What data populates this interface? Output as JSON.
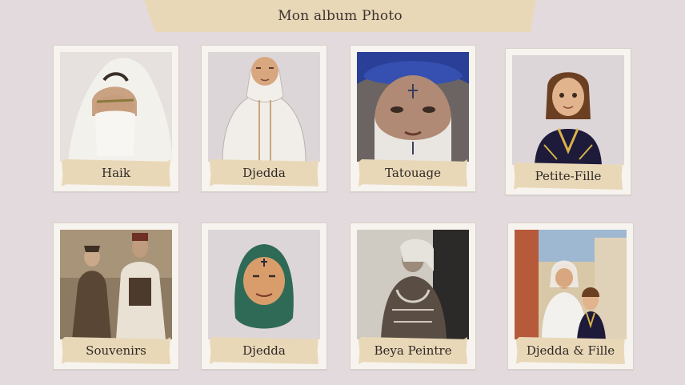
{
  "header": {
    "title": "Mon album Photo"
  },
  "cards": [
    {
      "label": "Haik",
      "icon": "haik-photo"
    },
    {
      "label": "Djedda",
      "icon": "djedda-illustration"
    },
    {
      "label": "Tatouage",
      "icon": "tatouage-photo"
    },
    {
      "label": "Petite-Fille",
      "icon": "petite-fille-illustration"
    },
    {
      "label": "Souvenirs",
      "icon": "souvenirs-photo"
    },
    {
      "label": "Djedda",
      "icon": "djedda-portrait-illustration"
    },
    {
      "label": "Beya Peintre",
      "icon": "beya-photo"
    },
    {
      "label": "Djedda & Fille",
      "icon": "djedda-fille-illustration"
    }
  ],
  "colors": {
    "background": "#e3dadd",
    "tape": "#e9d8b8",
    "card": "#f7f4ef",
    "text": "#2f2a27"
  }
}
